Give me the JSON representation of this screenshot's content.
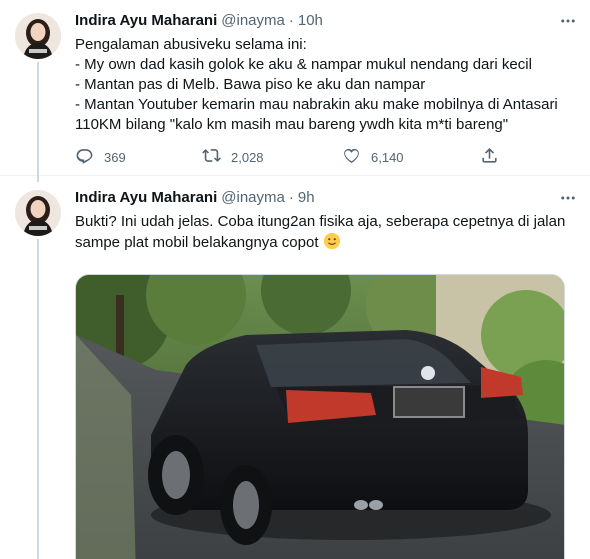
{
  "tweets": [
    {
      "author_name": "Indira Ayu Maharani",
      "handle": "@inayma",
      "separator": "·",
      "time": "10h",
      "lines": [
        "Pengalaman abusiveku selama ini:",
        "- My own dad kasih golok ke aku & nampar mukul nendang dari kecil",
        "- Mantan pas di Melb. Bawa piso ke aku dan nampar",
        "- Mantan Youtuber kemarin mau nabrakin aku make mobilnya di Antasari",
        "110KM bilang \"kalo km masih mau bareng ywdh kita m*ti bareng\""
      ],
      "replies": "369",
      "retweets": "2,028",
      "likes": "6,140"
    },
    {
      "author_name": "Indira Ayu Maharani",
      "handle": "@inayma",
      "separator": "·",
      "time": "9h",
      "lines": [
        "Bukti? Ini udah jelas. Coba itung2an fisika aja, seberapa cepetnya di jalan",
        "sampe plat mobil belakangnya copot"
      ],
      "emoji": "slightly-smiling-face"
    }
  ],
  "icons": {
    "reply": "reply-icon",
    "retweet": "retweet-icon",
    "like": "heart-icon",
    "share": "share-icon",
    "more": "more-icon"
  },
  "colors": {
    "text": "#0f1419",
    "secondary": "#536471",
    "border": "#eff3f4"
  }
}
